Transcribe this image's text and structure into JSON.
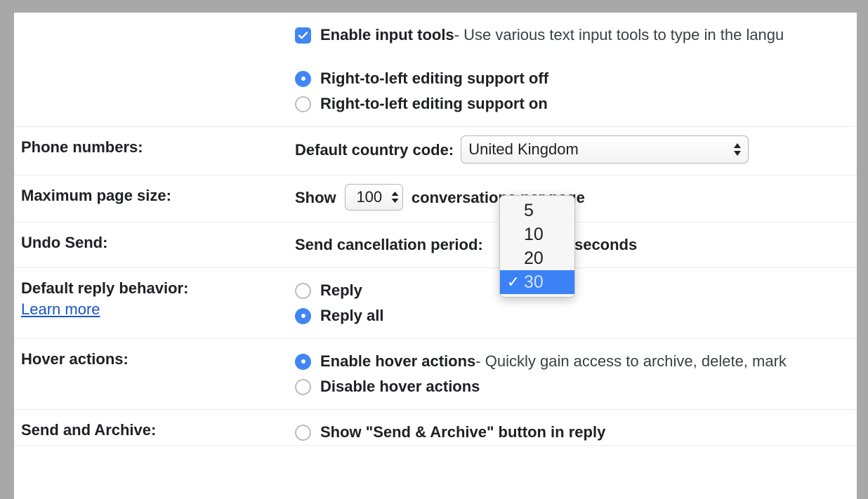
{
  "rows": [
    {
      "label": "",
      "options": [
        {
          "control": "checkbox",
          "checked": true,
          "strong": "Enable input tools",
          "rest": " - Use various text input tools to type in the langu"
        }
      ],
      "options2": [
        {
          "control": "radio",
          "checked": true,
          "strong": "Right-to-left editing support off",
          "rest": ""
        },
        {
          "control": "radio",
          "checked": false,
          "strong": "Right-to-left editing support on",
          "rest": ""
        }
      ]
    },
    {
      "label": "Phone numbers:",
      "prefix": "Default country code:",
      "select_value": "United Kingdom"
    },
    {
      "label": "Maximum page size:",
      "prefix": "Show",
      "stepper_value": "100",
      "suffix": "conversations per page"
    },
    {
      "label": "Undo Send:",
      "prefix": "Send cancellation period:",
      "suffix": "seconds"
    },
    {
      "label": "Default reply behavior:",
      "link": "Learn more",
      "options": [
        {
          "control": "radio",
          "checked": false,
          "strong": "Reply",
          "rest": ""
        },
        {
          "control": "radio",
          "checked": true,
          "strong": "Reply all",
          "rest": ""
        }
      ]
    },
    {
      "label": "Hover actions:",
      "options": [
        {
          "control": "radio",
          "checked": true,
          "strong": "Enable hover actions",
          "rest": " - Quickly gain access to archive, delete, mark"
        },
        {
          "control": "radio",
          "checked": false,
          "strong": "Disable hover actions",
          "rest": ""
        }
      ]
    },
    {
      "label": "Send and Archive:",
      "options": [
        {
          "control": "radio",
          "checked": false,
          "strong": "Show \"Send & Archive\" button in reply",
          "rest": ""
        }
      ]
    }
  ],
  "dropdown": {
    "name": "send-cancellation-period",
    "options": [
      "5",
      "10",
      "20",
      "30"
    ],
    "selected": "30",
    "check_glyph": "✓"
  },
  "colors": {
    "accent": "#4285f4",
    "highlight": "#3b82f6",
    "link": "#1a56c4",
    "text": "#202124",
    "divider": "#ebebeb",
    "chrome": "#a8a8a8"
  }
}
